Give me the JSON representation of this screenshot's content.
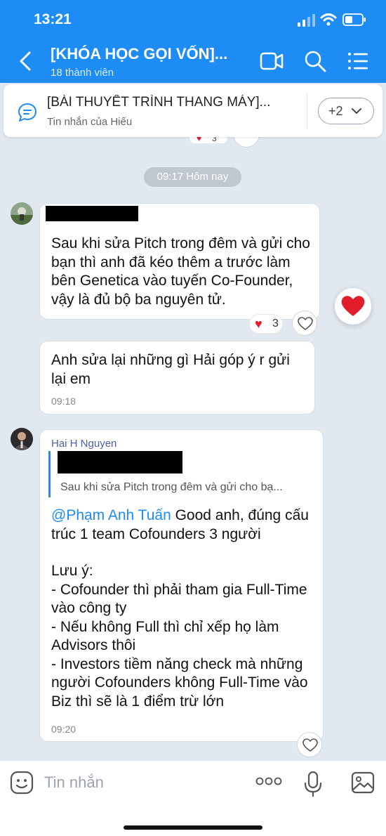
{
  "status_bar": {
    "time": "13:21"
  },
  "header": {
    "title": "[KHÓA HỌC GỌI VỐN]...",
    "subtitle": "18 thành viên",
    "icons": [
      "back-chevron-icon",
      "video-call-icon",
      "search-icon",
      "menu-list-icon"
    ]
  },
  "pinned": {
    "title": "[BÀI THUYẾT TRÌNH THANG MÁY]...",
    "subtitle": "Tin nhắn của Hiếu",
    "more_label": "+2"
  },
  "peek_reaction_count": "3",
  "date_separator": "09:17 Hôm nay",
  "messages": [
    {
      "text": "Sau khi sửa Pitch trong đêm và gửi cho bạn thì anh đã kéo thêm a trước làm bên Genetica vào tuyến Co-Founder, vậy là đủ bộ ba nguyên tử.",
      "reaction_count": "3"
    },
    {
      "text": "Anh sửa lại những gì Hải góp ý r gửi lại em",
      "time": "09:18"
    },
    {
      "sender": "Hai H Nguyen",
      "quote_text": "Sau khi sửa Pitch trong đêm và gửi cho bạ...",
      "mention": "@Phạm Anh Tuấn",
      "body_after_mention": " Good anh, đúng cấu trúc 1 team Cofounders 3 người",
      "body_lines": [
        "Lưu ý:",
        "- Cofounder thì phải tham gia Full-Time vào công ty",
        "- Nếu không Full thì chỉ xếp họ làm Advisors thôi",
        "- Investors tiềm năng check mà những người Cofounders không Full-Time vào Biz thì sẽ là 1 điểm trừ lớn"
      ],
      "time": "09:20"
    }
  ],
  "input": {
    "placeholder": "Tin nhắn"
  },
  "colors": {
    "accent": "#1e8cf5",
    "background": "#e2e8f0",
    "heart": "#e11d2a"
  }
}
